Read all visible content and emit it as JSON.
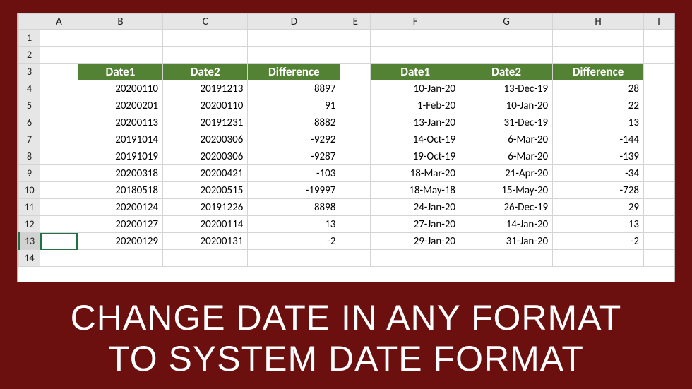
{
  "columns": [
    "A",
    "B",
    "C",
    "D",
    "E",
    "F",
    "G",
    "H",
    "I"
  ],
  "rowCount": 14,
  "selectedRow": 13,
  "selectedCell": "A13",
  "headers": {
    "left": {
      "date1": "Date1",
      "date2": "Date2",
      "diff": "Difference"
    },
    "right": {
      "date1": "Date1",
      "date2": "Date2",
      "diff": "Difference"
    }
  },
  "leftTable": [
    {
      "d1": "20200110",
      "d2": "20191213",
      "diff": "8897"
    },
    {
      "d1": "20200201",
      "d2": "20200110",
      "diff": "91"
    },
    {
      "d1": "20200113",
      "d2": "20191231",
      "diff": "8882"
    },
    {
      "d1": "20191014",
      "d2": "20200306",
      "diff": "-9292"
    },
    {
      "d1": "20191019",
      "d2": "20200306",
      "diff": "-9287"
    },
    {
      "d1": "20200318",
      "d2": "20200421",
      "diff": "-103"
    },
    {
      "d1": "20180518",
      "d2": "20200515",
      "diff": "-19997"
    },
    {
      "d1": "20200124",
      "d2": "20191226",
      "diff": "8898"
    },
    {
      "d1": "20200127",
      "d2": "20200114",
      "diff": "13"
    },
    {
      "d1": "20200129",
      "d2": "20200131",
      "diff": "-2"
    }
  ],
  "rightTable": [
    {
      "d1": "10-Jan-20",
      "d2": "13-Dec-19",
      "diff": "28"
    },
    {
      "d1": "1-Feb-20",
      "d2": "10-Jan-20",
      "diff": "22"
    },
    {
      "d1": "13-Jan-20",
      "d2": "31-Dec-19",
      "diff": "13"
    },
    {
      "d1": "14-Oct-19",
      "d2": "6-Mar-20",
      "diff": "-144"
    },
    {
      "d1": "19-Oct-19",
      "d2": "6-Mar-20",
      "diff": "-139"
    },
    {
      "d1": "18-Mar-20",
      "d2": "21-Apr-20",
      "diff": "-34"
    },
    {
      "d1": "18-May-18",
      "d2": "15-May-20",
      "diff": "-728"
    },
    {
      "d1": "24-Jan-20",
      "d2": "26-Dec-19",
      "diff": "29"
    },
    {
      "d1": "27-Jan-20",
      "d2": "14-Jan-20",
      "diff": "13"
    },
    {
      "d1": "29-Jan-20",
      "d2": "31-Jan-20",
      "diff": "-2"
    }
  ],
  "caption": {
    "line1": "CHANGE DATE IN ANY FORMAT",
    "line2": "TO SYSTEM DATE FORMAT"
  }
}
